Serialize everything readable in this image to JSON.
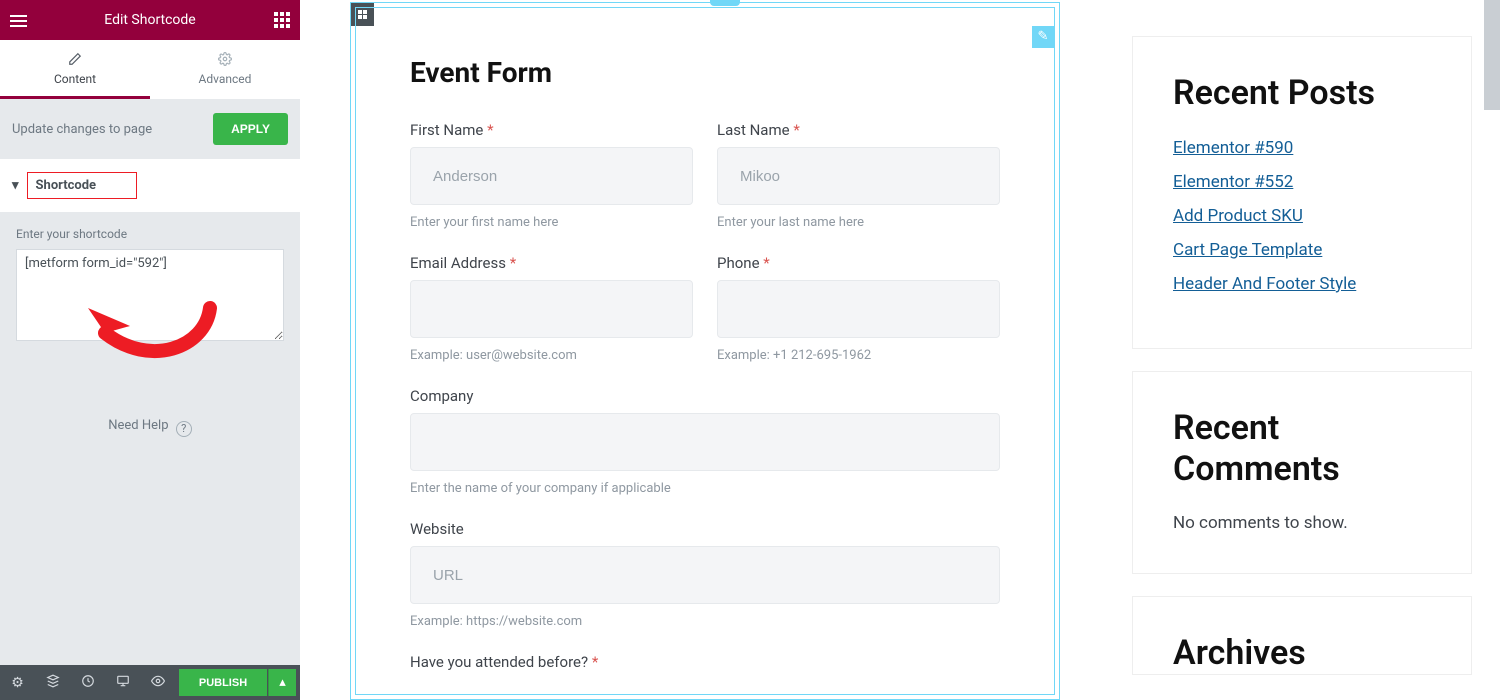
{
  "panel": {
    "title": "Edit Shortcode",
    "tabs": {
      "content": "Content",
      "advanced": "Advanced"
    },
    "apply_label": "APPLY",
    "update_text": "Update changes to page",
    "section_label": "Shortcode",
    "shortcode_label": "Enter your shortcode",
    "shortcode_value": "[metform form_id=\"592\"]",
    "help": "Need Help",
    "publish": "PUBLISH"
  },
  "form": {
    "title": "Event Form",
    "first_name": {
      "label": "First Name",
      "placeholder": "Anderson",
      "hint": "Enter your first name here"
    },
    "last_name": {
      "label": "Last Name",
      "placeholder": "Mikoo",
      "hint": "Enter your last name here"
    },
    "email": {
      "label": "Email Address",
      "hint": "Example: user@website.com"
    },
    "phone": {
      "label": "Phone",
      "hint": "Example: +1 212-695-1962"
    },
    "company": {
      "label": "Company",
      "hint": "Enter the name of your company if applicable"
    },
    "website": {
      "label": "Website",
      "placeholder": "URL",
      "hint": "Example: https://website.com"
    },
    "attended": {
      "label": "Have you attended before?"
    }
  },
  "sidebar": {
    "recent_posts_title": "Recent Posts",
    "posts": [
      "Elementor #590",
      "Elementor #552",
      "Add Product SKU",
      "Cart Page Template",
      "Header And Footer Style"
    ],
    "recent_comments_title": "Recent Comments",
    "no_comments": "No comments to show.",
    "archives_title": "Archives"
  }
}
